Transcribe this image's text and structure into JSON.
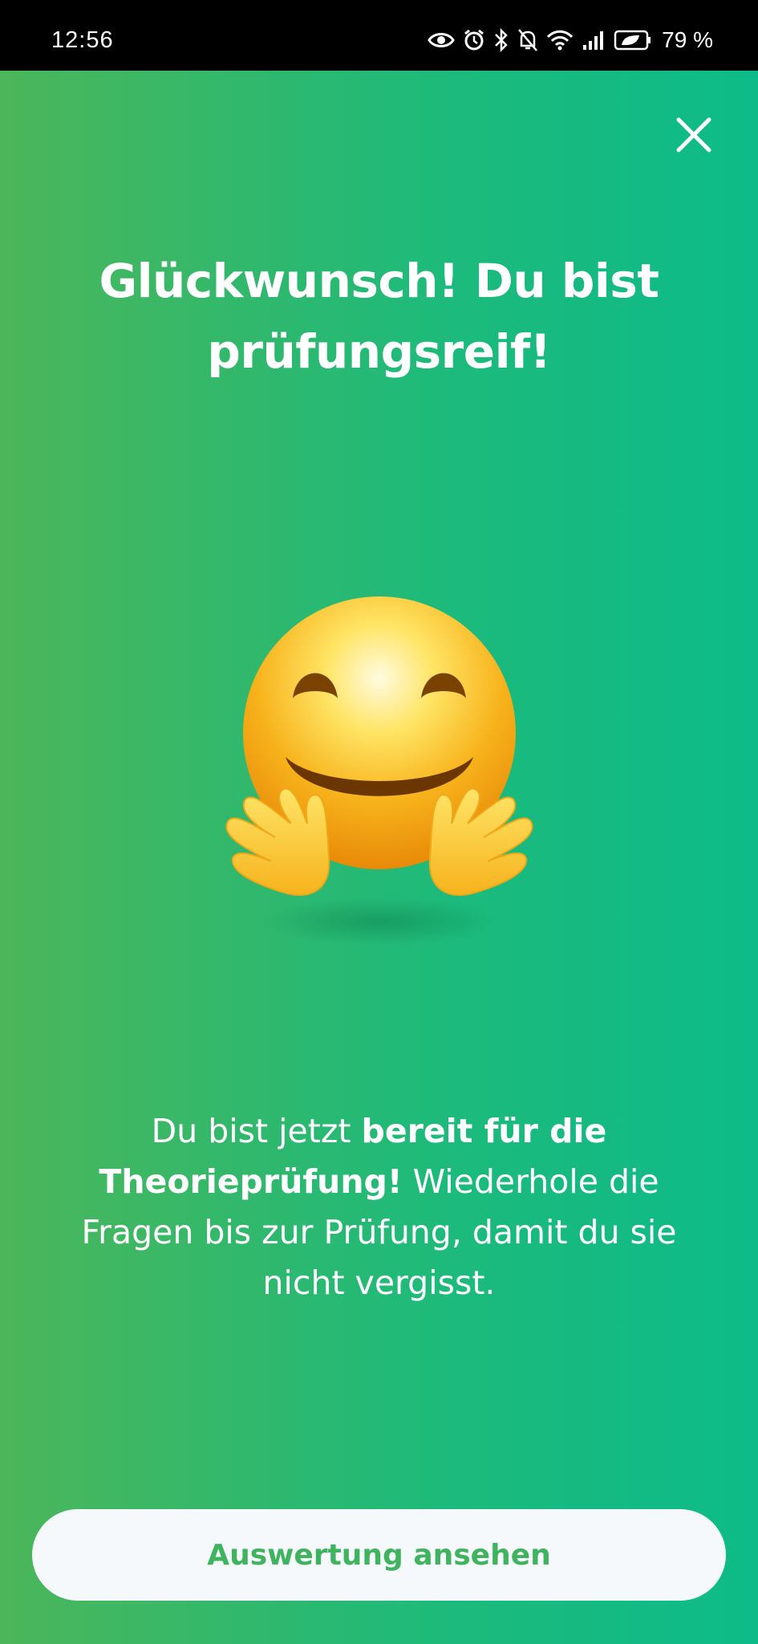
{
  "status_bar": {
    "time": "12:56",
    "battery": "79 %",
    "icons": [
      "eye-icon",
      "alarm-icon",
      "bluetooth-icon",
      "bell-off-icon",
      "wifi-icon",
      "signal-icon",
      "battery-icon"
    ]
  },
  "dialog": {
    "close_icon": "close-icon",
    "title": "Glückwunsch! Du bist prüfungsreif!",
    "emoji": "hugging-face-emoji",
    "message": {
      "part1": "Du bist jetzt ",
      "bold": "bereit für die Theorieprüfung!",
      "part2": " Wiederhole die Fragen bis zur Prüfung, damit du sie nicht vergisst."
    },
    "primary_button": "Auswertung ansehen"
  },
  "colors": {
    "gradient_left": "#4cb65a",
    "gradient_right": "#0dbb88",
    "button_bg": "#f6f9fc",
    "button_text": "#3fb35e"
  }
}
